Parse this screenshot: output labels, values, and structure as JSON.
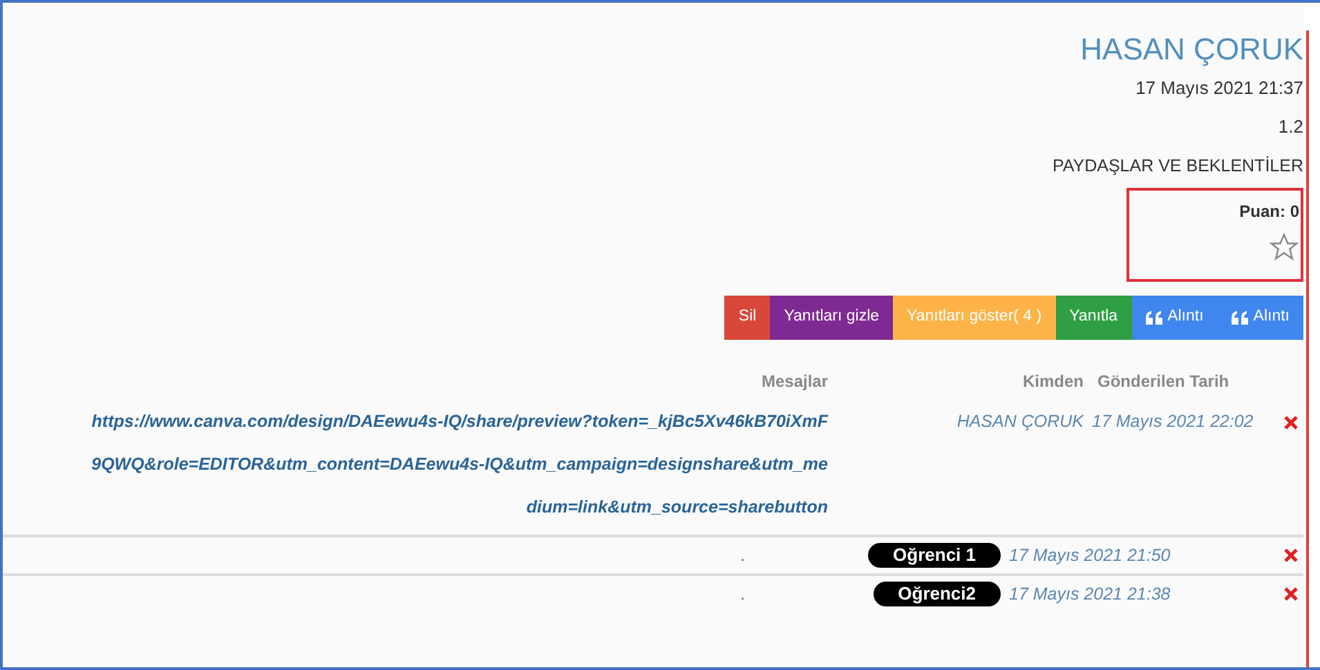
{
  "post": {
    "author": "HASAN ÇORUK",
    "date": "17 Mayıs 2021 21:37",
    "number": "1.2",
    "topic": "PAYDAŞLAR VE BEKLENTİLER",
    "score": "Puan: 0",
    "starred": false
  },
  "buttons": [
    {
      "label": "Sil",
      "color": "#d9473a",
      "kind": "plain"
    },
    {
      "label": "Yanıtları gizle",
      "color": "#7f2a93",
      "kind": "plain"
    },
    {
      "label": "Yanıtları göster( 4 )",
      "color": "#fdb347",
      "kind": "plain"
    },
    {
      "label": "Yanıtla",
      "color": "#2f9e44",
      "kind": "plain"
    },
    {
      "label": "Alıntı",
      "color": "#3f86ee",
      "kind": "quote"
    },
    {
      "label": "Alıntı",
      "color": "#3f86ee",
      "kind": "quote"
    }
  ],
  "table": {
    "columns": [
      "Mesajlar",
      "Kimden",
      "Gönderilen Tarih"
    ],
    "rows": [
      {
        "message": "https://www.canva.com/design/DAEewu4s-IQ/share/preview?token=_kjBc5Xv46kB70iXmF9QWQ&role=EDITOR&utm_content=DAEewu4s-IQ&utm_campaign=designshare&utm_medium=link&utm_source=sharebutton",
        "kind": "link",
        "from": "HASAN ÇORUK",
        "masked": false,
        "date": "17 Mayıs 2021 22:02"
      },
      {
        "message": ".",
        "kind": "text",
        "from": "Oğrenci 1",
        "masked": true,
        "date": "17 Mayıs 2021 21:50"
      },
      {
        "message": ".",
        "kind": "text",
        "from": "Oğrenci2",
        "masked": true,
        "date": "17 Mayıs 2021 21:38"
      }
    ]
  }
}
